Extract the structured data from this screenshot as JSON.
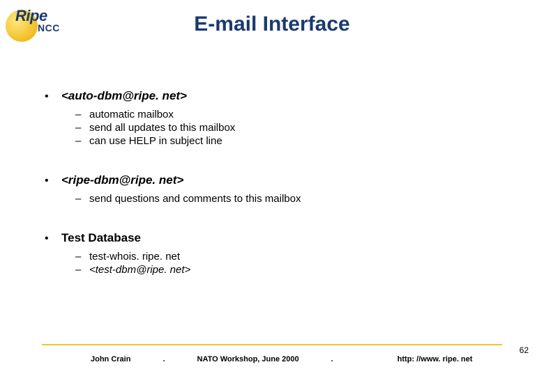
{
  "logo": {
    "ripe": "Ripe",
    "ncc": "NCC"
  },
  "title": "E-mail Interface",
  "sections": [
    {
      "heading": "<auto-dbm@ripe. net>",
      "headingItalic": true,
      "items": [
        {
          "text": "automatic mailbox",
          "italic": false
        },
        {
          "text": "send all updates to this mailbox",
          "italic": false
        },
        {
          "text": "can use HELP in subject line",
          "italic": false
        }
      ]
    },
    {
      "heading": "<ripe-dbm@ripe. net>",
      "headingItalic": true,
      "items": [
        {
          "text": "send questions and comments to this mailbox",
          "italic": false
        }
      ]
    },
    {
      "heading": "Test Database",
      "headingItalic": false,
      "items": [
        {
          "text": "test-whois. ripe. net",
          "italic": false
        },
        {
          "text": "<test-dbm@ripe. net>",
          "italic": true
        }
      ]
    }
  ],
  "footer": {
    "author": "John Crain",
    "sep": ".",
    "event": "NATO Workshop, June 2000",
    "url": "http: //www. ripe. net"
  },
  "pageNumber": "62"
}
